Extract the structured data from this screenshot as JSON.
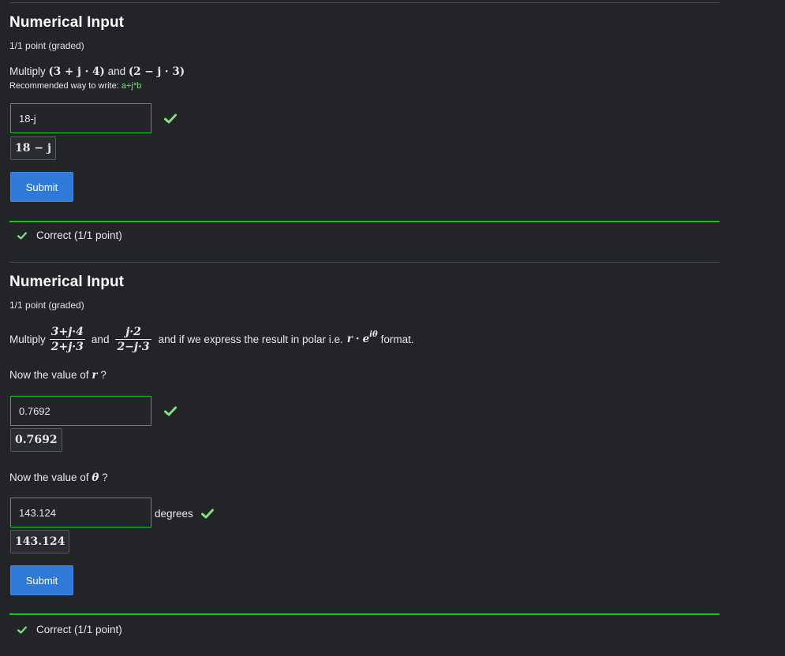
{
  "problem1": {
    "title": "Numerical Input",
    "points": "1/1 point (graded)",
    "question": {
      "prefix": "Multiply",
      "expr1": "(3 + j · 4)",
      "conj": "and",
      "expr2": "(2 − j · 3)"
    },
    "hint": {
      "label": "Recommended way to write:",
      "code": "a+j*b"
    },
    "input_value": "18-j",
    "preview": "18 − j",
    "submit_label": "Submit",
    "feedback": "Correct (1/1 point)"
  },
  "problem2": {
    "title": "Numerical Input",
    "points": "1/1 point (graded)",
    "question": {
      "prefix": "Multiply",
      "frac1_num": "3+j·4",
      "frac1_den": "2+j·3",
      "conj": "and",
      "frac2_num": "j·2",
      "frac2_den": "2−j·3",
      "suffix_pre": "and if we express the result in polar i.e.",
      "polar_r": "r",
      "polar_dot": "·",
      "polar_e": "e",
      "polar_exp": "iθ",
      "suffix_post": "format."
    },
    "sub1": {
      "label": "Now the value of",
      "var": "r",
      "q": "?",
      "input_value": "0.7692",
      "preview": "0.7692"
    },
    "sub2": {
      "label": "Now the value of",
      "var": "θ",
      "q": "?",
      "input_value": "143.124",
      "preview": "143.124",
      "units": "degrees"
    },
    "submit_label": "Submit",
    "feedback": "Correct (1/1 point)"
  },
  "colors": {
    "background": "#222427",
    "success": "#14c81e",
    "check": "#7ee47e",
    "button": "#2f7ad9"
  },
  "icons": {
    "correct": "check-icon"
  }
}
